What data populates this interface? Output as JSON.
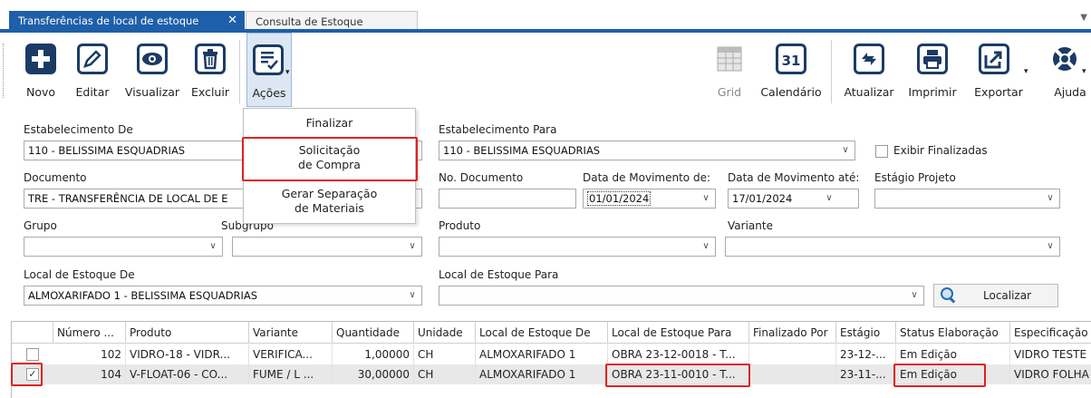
{
  "tabs": [
    {
      "label": "Transferências de local de estoque",
      "close": "✕"
    },
    {
      "label": "Consulta de Estoque"
    }
  ],
  "toolbar": {
    "novo": "Novo",
    "editar": "Editar",
    "visualizar": "Visualizar",
    "excluir": "Excluir",
    "acoes": "Ações",
    "grid": "Grid",
    "calendario": "Calendário",
    "atualizar": "Atualizar",
    "imprimir": "Imprimir",
    "exportar": "Exportar",
    "ajuda": "Ajuda",
    "calendar_day": "31"
  },
  "menu": {
    "finalizar": "Finalizar",
    "solicitacao_1": "Solicitação",
    "solicitacao_2": "de Compra",
    "gerar_1": "Gerar Separação",
    "gerar_2": "de Materiais"
  },
  "form": {
    "estab_de_label": "Estabelecimento De",
    "estab_de_value": "110 - BELISSIMA ESQUADRIAS",
    "estab_para_label": "Estabelecimento Para",
    "estab_para_value": "110 - BELISSIMA ESQUADRIAS",
    "exibir_finalizadas": "Exibir Finalizadas",
    "documento_label": "Documento",
    "documento_value": "TRE - TRANSFERÊNCIA DE LOCAL DE E",
    "no_documento_label": "No. Documento",
    "no_documento_value": "",
    "data_de_label": "Data de Movimento de:",
    "data_de_value": "01/01/2024",
    "data_ate_label": "Data de Movimento até:",
    "data_ate_value": "17/01/2024",
    "estagio_projeto_label": "Estágio Projeto",
    "grupo_label": "Grupo",
    "subgrupo_label": "Subgrupo",
    "produto_label": "Produto",
    "variante_label": "Variante",
    "local_de_label": "Local de Estoque De",
    "local_de_value": "ALMOXARIFADO 1 - BELISSIMA ESQUADRIAS",
    "local_para_label": "Local de Estoque Para",
    "localizar": "Localizar"
  },
  "table": {
    "headers": [
      "Número ...",
      "Produto",
      "Variante",
      "Quantidade",
      "Unidade",
      "Local de Estoque De",
      "Local de Estoque Para",
      "Finalizado Por",
      "Estágio",
      "Status Elaboração",
      "Especificação"
    ],
    "rows": [
      [
        "102",
        "VIDRO-18 - VIDR...",
        "VERIFICA...",
        "1,00000",
        "CH",
        "ALMOXARIFADO 1",
        "OBRA 23-12-0018 - T...",
        "",
        "23-12-...",
        "Em Edição",
        "VIDRO TESTE"
      ],
      [
        "104",
        "V-FLOAT-06 - CO...",
        "FUME / L ...",
        "30,00000",
        "CH",
        "ALMOXARIFADO 1",
        "OBRA 23-11-0010 - T...",
        "",
        "23-11-...",
        "Em Edição",
        "VIDRO FOLHA"
      ]
    ],
    "checked": [
      false,
      true
    ]
  },
  "colors": {
    "accent": "#1e5faa",
    "highlight": "#e02020",
    "icon": "#1b3b66"
  }
}
